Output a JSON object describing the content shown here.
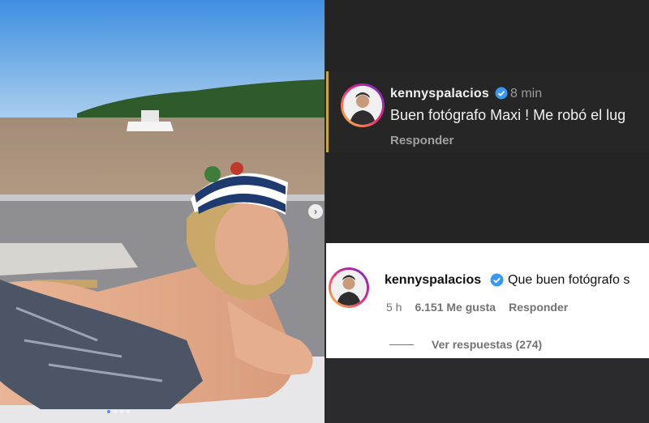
{
  "photo": {
    "carousel_count": 4,
    "carousel_active": 0,
    "next_icon": "›"
  },
  "comment_dark": {
    "username": "kennyspalacios",
    "time": "8 min",
    "text": "Buen fotógrafo Maxi ! Me robó el lug",
    "reply_label": "Responder"
  },
  "comment_light": {
    "username": "kennyspalacios",
    "text": "Que buen fotógrafo s",
    "time": "5 h",
    "likes": "6.151 Me gusta",
    "reply_label": "Responder",
    "view_replies": "Ver respuestas (274)"
  },
  "colors": {
    "verified": "#3897f0",
    "ring_start": "#f9ce34",
    "ring_end": "#6228d7"
  }
}
